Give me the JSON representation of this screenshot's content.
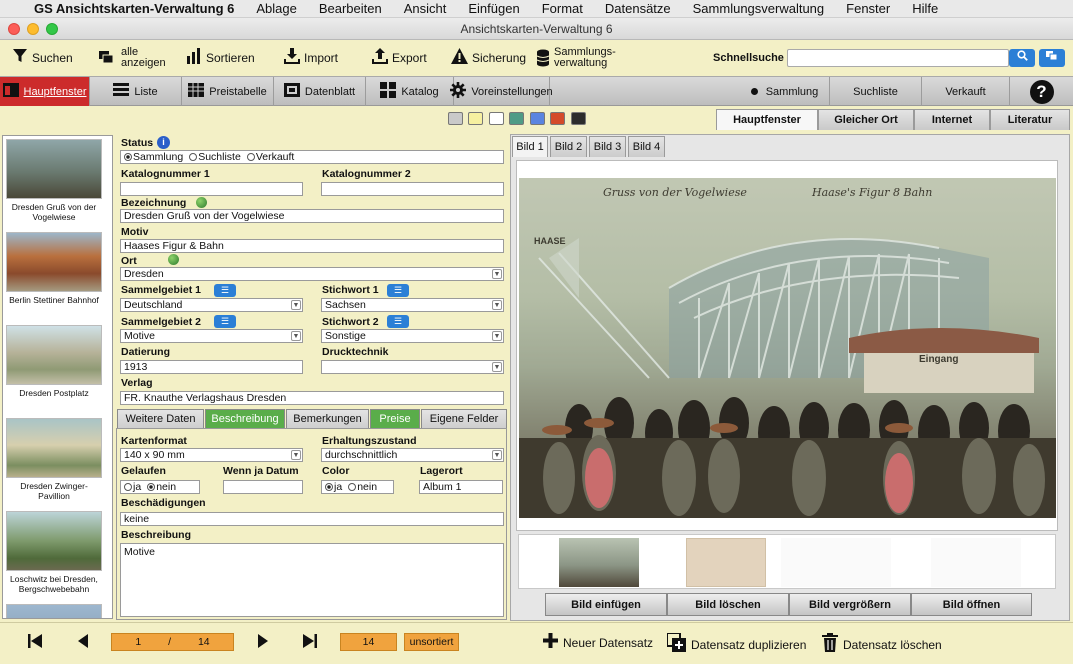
{
  "menubar": {
    "app_name": "GS Ansichtskarten-Verwaltung 6",
    "items": [
      "Ablage",
      "Bearbeiten",
      "Ansicht",
      "Einfügen",
      "Format",
      "Datensätze",
      "Sammlungsverwaltung",
      "Fenster",
      "Hilfe"
    ]
  },
  "window": {
    "title": "Ansichtskarten-Verwaltung 6"
  },
  "toolbar": {
    "search": "Suchen",
    "show_all": [
      "alle",
      "anzeigen"
    ],
    "sort": "Sortieren",
    "import": "Import",
    "export": "Export",
    "backup": "Sicherung",
    "collection_mgmt": [
      "Sammlungs-",
      "verwaltung"
    ],
    "quick_search_label": "Schnellsuche",
    "quick_search_value": ""
  },
  "toolbar2": {
    "main_window": "Hauptfenster",
    "list": "Liste",
    "price_table": "Preistabelle",
    "data_sheet": "Datenblatt",
    "catalog": "Katalog",
    "preferences": "Voreinstellungen",
    "collection": "Sammlung",
    "search_list": "Suchliste",
    "sale": "Verkauft"
  },
  "swatch_colors": [
    "#c9c9c9",
    "#f6f0a0",
    "#ffffff",
    "#4f9b86",
    "#5a84e0",
    "#d44a2a",
    "#2c2c2c"
  ],
  "right_tabs": [
    "Hauptfenster",
    "Gleicher Ort",
    "Internet",
    "Literatur"
  ],
  "thumbnails": [
    {
      "caption": "Dresden Gruß von der Vogelwiese"
    },
    {
      "caption": "Berlin Stettiner Bahnhof"
    },
    {
      "caption": "Dresden Postplatz"
    },
    {
      "caption": "Dresden Zwinger-Pavillion"
    },
    {
      "caption": "Loschwitz bei Dresden, Bergschwebebahn"
    }
  ],
  "form": {
    "status_label": "Status",
    "status_options": [
      "Sammlung",
      "Suchliste",
      "Verkauft"
    ],
    "status_selected": "Sammlung",
    "katalognummer1_label": "Katalognummer  1",
    "katalognummer1": "",
    "katalognummer2_label": "Katalognummer 2",
    "katalognummer2": "",
    "bezeichnung_label": "Bezeichnung",
    "bezeichnung": "Dresden Gruß von der Vogelwiese",
    "motiv_label": "Motiv",
    "motiv": "Haases Figur & Bahn",
    "ort_label": "Ort",
    "ort": "Dresden",
    "sammelgebiet1_label": "Sammelgebiet  1",
    "sammelgebiet1": "Deutschland",
    "stichwort1_label": "Stichwort 1",
    "stichwort1": "Sachsen",
    "sammelgebiet2_label": "Sammelgebiet  2",
    "sammelgebiet2": "Motive",
    "stichwort2_label": "Stichwort 2",
    "stichwort2": "Sonstige",
    "datierung_label": "Datierung",
    "datierung": "1913",
    "drucktechnik_label": "Drucktechnik",
    "drucktechnik": "",
    "verlag_label": "Verlag",
    "verlag": "FR. Knauthe Verlagshaus Dresden"
  },
  "form_tabs": [
    "Weitere Daten",
    "Beschreibung",
    "Bemerkungen",
    "Preise",
    "Eigene Felder"
  ],
  "details": {
    "kartenformat_label": "Kartenformat",
    "kartenformat": "140 x  90 mm",
    "erhaltung_label": "Erhaltungszustand",
    "erhaltung": "durchschnittlich",
    "gelaufen_label": "Gelaufen",
    "gelaufen_options": [
      "ja",
      "nein"
    ],
    "gelaufen_selected": "nein",
    "datum_label": "Wenn ja Datum",
    "datum": "",
    "color_label": "Color",
    "color_options": [
      "ja",
      "nein"
    ],
    "color_selected": "ja",
    "lagerort_label": "Lagerort",
    "lagerort": "Album 1",
    "beschaedigungen_label": "Beschädigungen",
    "beschaedigungen": "keine",
    "beschreibung_label": "Beschreibung",
    "beschreibung": "Motive"
  },
  "image_tabs": [
    "Bild 1",
    "Bild 2",
    "Bild 3",
    "Bild 4"
  ],
  "postcard": {
    "caption_left": "Gruss von der Vogelwiese",
    "caption_right": "Haase's Figur 8 Bahn",
    "sign1": "HAASE",
    "sign2": "Eingang"
  },
  "image_buttons": [
    "Bild einfügen",
    "Bild löschen",
    "Bild vergrößern",
    "Bild öffnen"
  ],
  "bottom": {
    "record_current": "1",
    "record_sep": "/",
    "record_total": "14",
    "found_count": "14",
    "sort_state": "unsortiert",
    "new_record": "Neuer Datensatz",
    "duplicate_record": "Datensatz duplizieren",
    "delete_record": "Datensatz löschen"
  }
}
